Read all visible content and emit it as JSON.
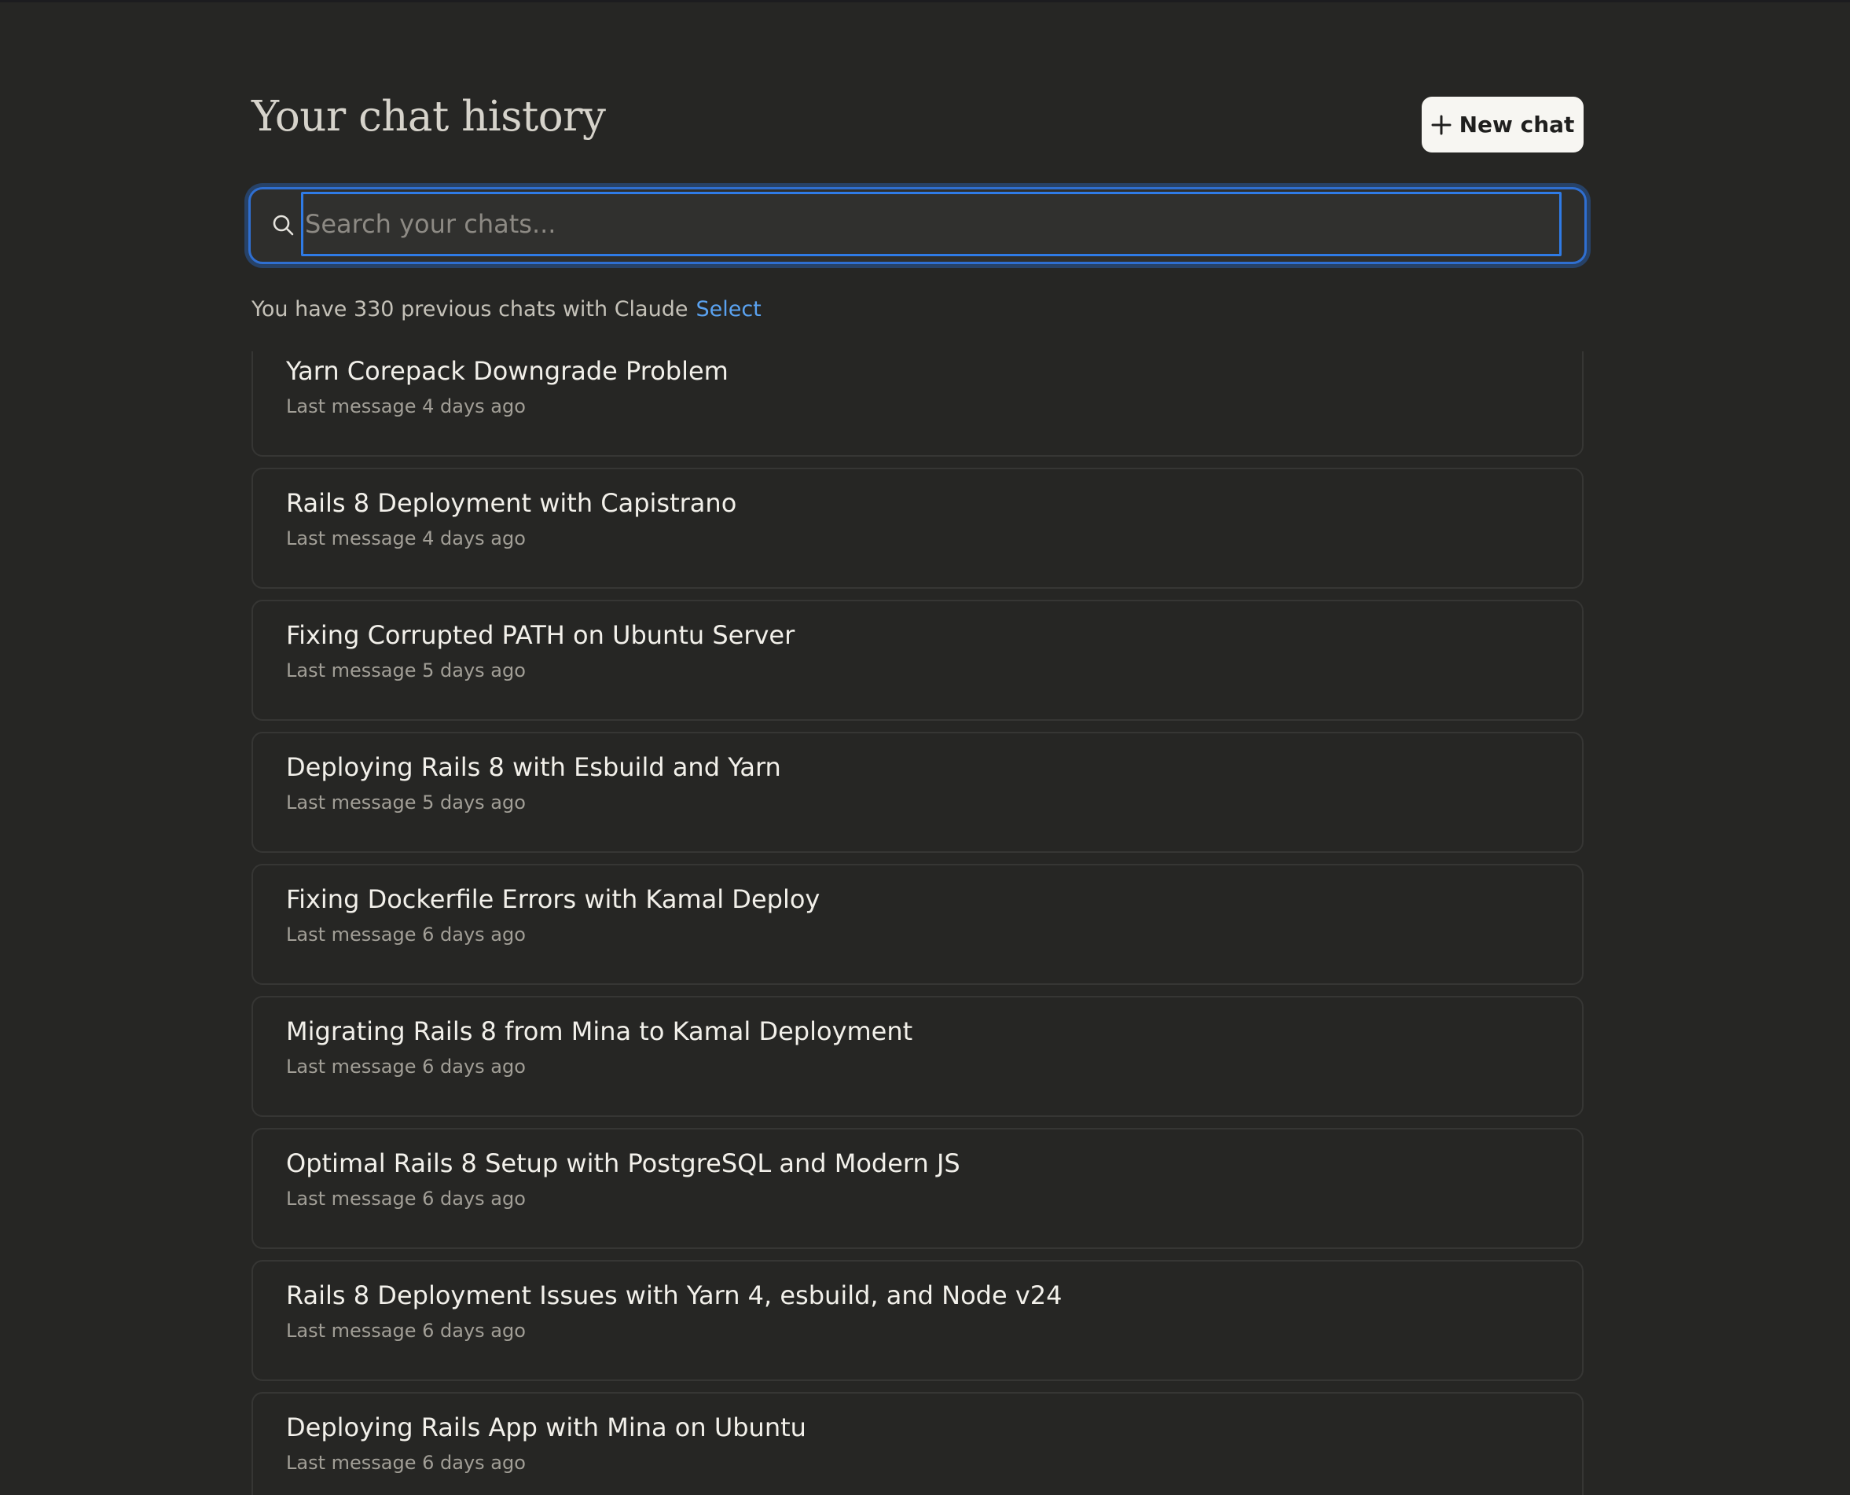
{
  "header": {
    "title": "Your chat history",
    "new_chat_label": "New chat",
    "new_chat_icon": "plus-icon"
  },
  "search": {
    "placeholder": "Search your chats...",
    "value": "",
    "icon": "search-icon"
  },
  "summary": {
    "text": "You have 330 previous chats with Claude",
    "select_label": "Select"
  },
  "colors": {
    "background": "#262624",
    "accent_link": "#5aa2f0",
    "focus_ring": "#2f7be6"
  },
  "chats": [
    {
      "title": "Yarn Corepack Downgrade Problem",
      "meta": "Last message 4 days ago"
    },
    {
      "title": "Rails 8 Deployment with Capistrano",
      "meta": "Last message 4 days ago"
    },
    {
      "title": "Fixing Corrupted PATH on Ubuntu Server",
      "meta": "Last message 5 days ago"
    },
    {
      "title": "Deploying Rails 8 with Esbuild and Yarn",
      "meta": "Last message 5 days ago"
    },
    {
      "title": "Fixing Dockerfile Errors with Kamal Deploy",
      "meta": "Last message 6 days ago"
    },
    {
      "title": "Migrating Rails 8 from Mina to Kamal Deployment",
      "meta": "Last message 6 days ago"
    },
    {
      "title": "Optimal Rails 8 Setup with PostgreSQL and Modern JS",
      "meta": "Last message 6 days ago"
    },
    {
      "title": "Rails 8 Deployment Issues with Yarn 4, esbuild, and Node v24",
      "meta": "Last message 6 days ago"
    },
    {
      "title": "Deploying Rails App with Mina on Ubuntu",
      "meta": "Last message 6 days ago"
    }
  ]
}
